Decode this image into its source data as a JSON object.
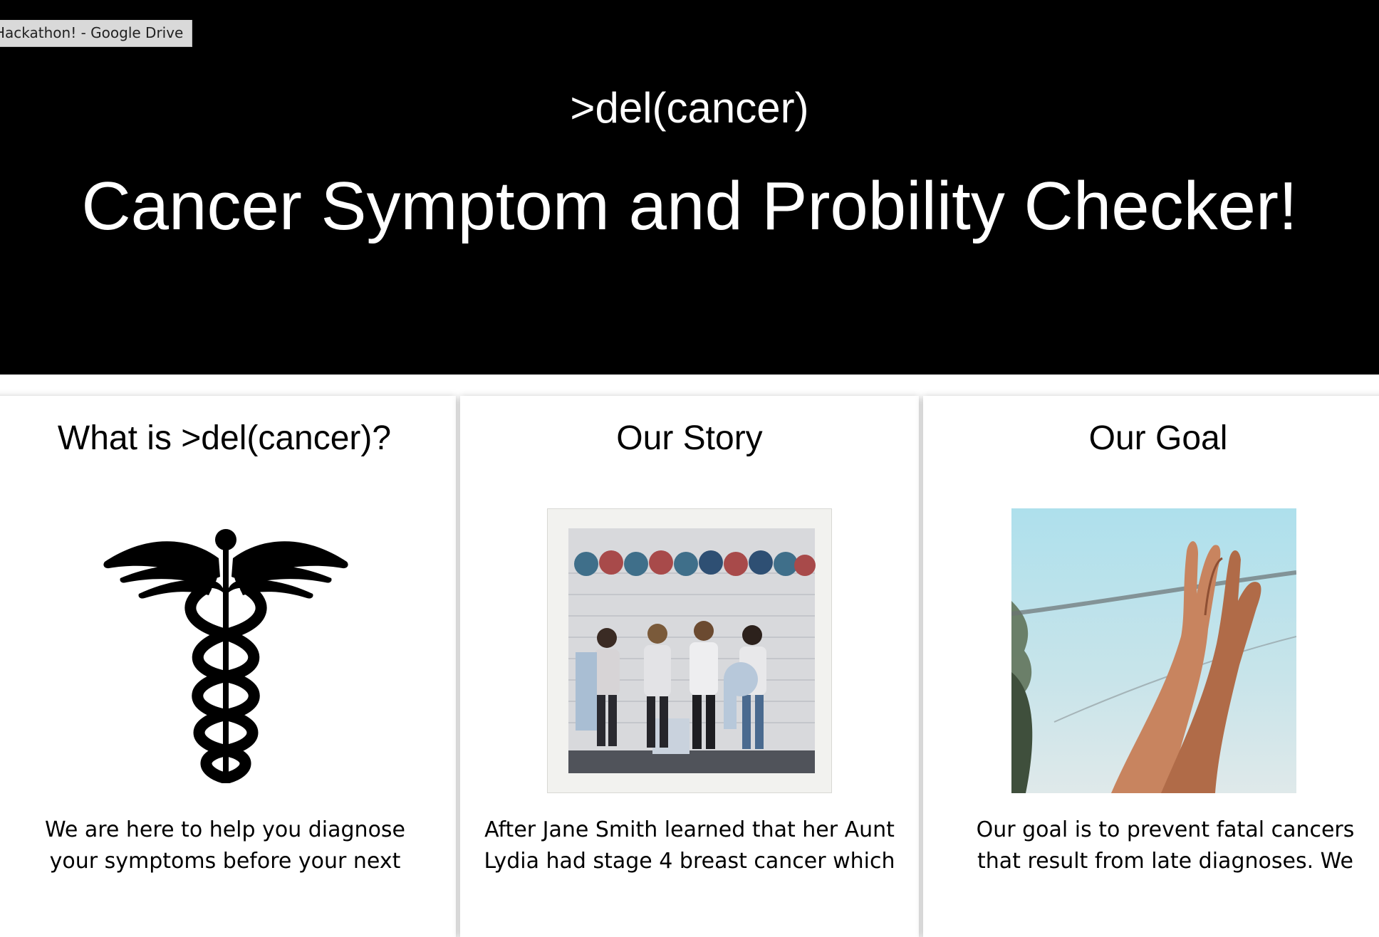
{
  "tooltip": {
    "text": "Hackathon! - Google Drive"
  },
  "hero": {
    "subtitle": ">del(cancer)",
    "title": "Cancer Symptom and Probility Checker!"
  },
  "cards": [
    {
      "title": "What is >del(cancer)?",
      "image_icon": "caduceus-icon",
      "text": "We are here to help you diagnose your symptoms before your next"
    },
    {
      "title": "Our Story",
      "image_icon": "team-photo",
      "text": "After Jane Smith learned that her Aunt Lydia had stage 4 breast cancer which"
    },
    {
      "title": "Our Goal",
      "image_icon": "high-five-photo",
      "text": "Our goal is to prevent fatal cancers that result from late diagnoses. We"
    }
  ],
  "colors": {
    "hero_background": "#000000",
    "hero_text": "#ffffff",
    "page_background": "#ffffff"
  }
}
